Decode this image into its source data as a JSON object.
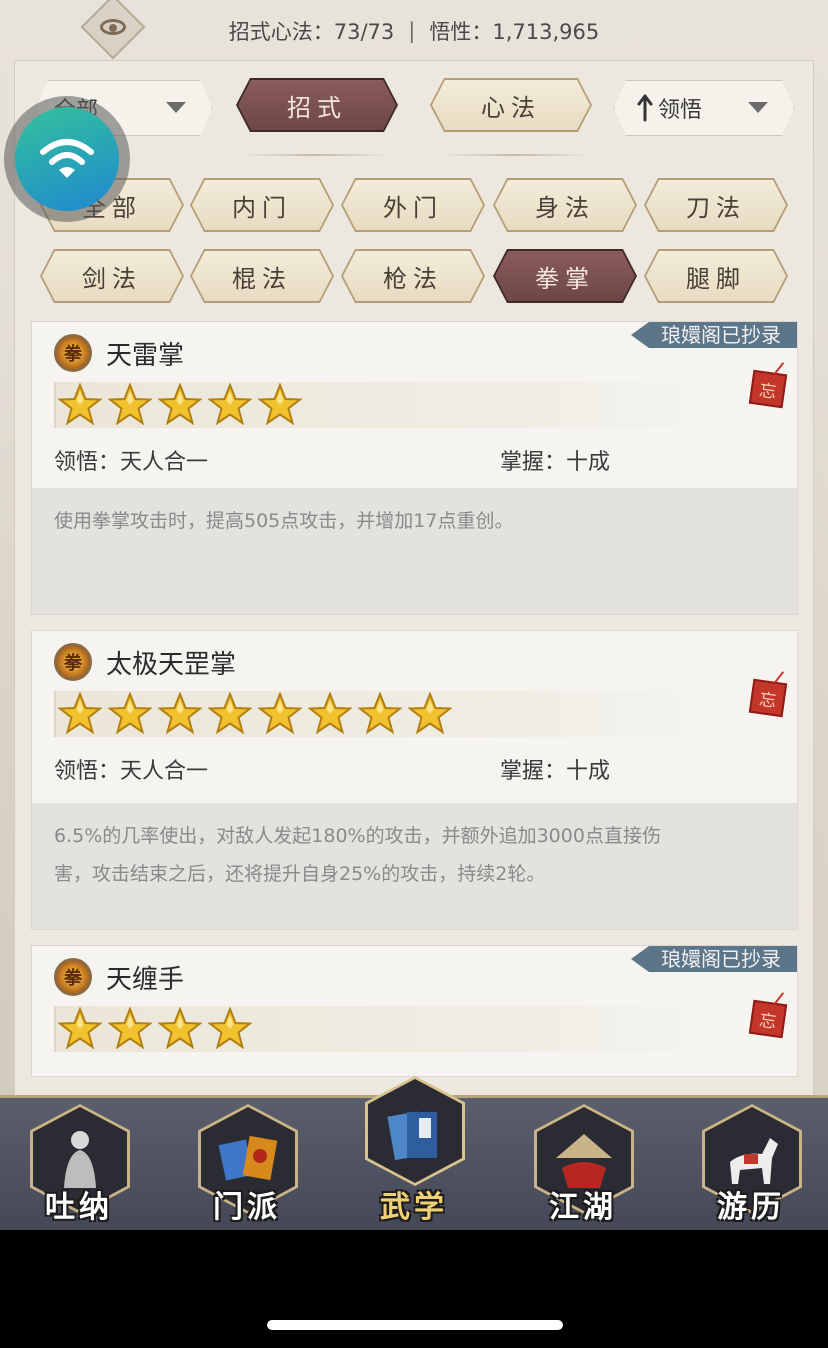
{
  "topbar": {
    "moves_label": "招式心法：73/73",
    "separator": "|",
    "insight_label": "悟性：1,713,965"
  },
  "filters": {
    "left_select": "全部",
    "tabs": [
      "招式",
      "心法"
    ],
    "active_tab": "招式",
    "sort_select": "领悟"
  },
  "categories": {
    "row1": [
      "全部",
      "内门",
      "外门",
      "身法",
      "刀法"
    ],
    "row2": [
      "剑法",
      "棍法",
      "枪法",
      "拳掌",
      "腿脚"
    ],
    "active": "拳掌"
  },
  "skills": [
    {
      "name": "天雷掌",
      "stars": 5,
      "insight": "领悟：天人合一",
      "mastery": "掌握：十成",
      "description": "使用拳掌攻击时，提高505点攻击，并增加17点重创。",
      "tag": "琅嬛阁已抄录",
      "seal": "忘"
    },
    {
      "name": "太极天罡掌",
      "stars": 8,
      "insight": "领悟：天人合一",
      "mastery": "掌握：十成",
      "description_line1": "6.5%的几率使出，对敌人发起180%的攻击，并额外追加3000点直接伤",
      "description_line2": "害，攻击结束之后，还将提升自身25%的攻击，持续2轮。",
      "seal": "忘"
    },
    {
      "name": "天缠手",
      "stars": 4,
      "tag": "琅嬛阁已抄录",
      "seal": "忘"
    }
  ],
  "bottom_nav": [
    {
      "label": "吐纳",
      "icon": "meditating-figure-icon"
    },
    {
      "label": "门派",
      "icon": "sect-banners-icon"
    },
    {
      "label": "武学",
      "icon": "martial-arts-books-icon"
    },
    {
      "label": "江湖",
      "icon": "bamboo-hat-icon"
    },
    {
      "label": "游历",
      "icon": "white-horse-icon"
    }
  ],
  "active_nav": "武学",
  "colors": {
    "active_button": "#7a5050",
    "tag_bg": "#5c7589",
    "star_gold": "#f2c12e",
    "seal_red": "#c4362a",
    "nav_bg": "#4f5260"
  }
}
